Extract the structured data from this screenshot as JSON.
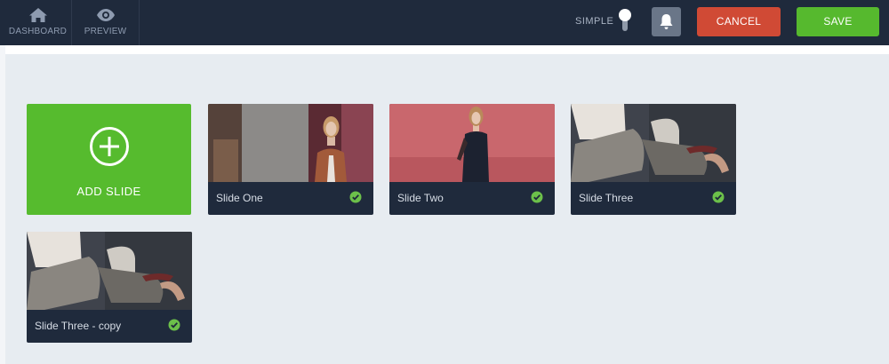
{
  "nav": {
    "dashboard_label": "DASHBOARD",
    "preview_label": "PREVIEW"
  },
  "header": {
    "mode_label": "SIMPLE",
    "cancel_label": "CANCEL",
    "save_label": "SAVE"
  },
  "add_slide": {
    "label": "ADD SLIDE"
  },
  "slides": [
    {
      "name": "Slide One",
      "status": "complete"
    },
    {
      "name": "Slide Two",
      "status": "complete"
    },
    {
      "name": "Slide Three",
      "status": "complete"
    },
    {
      "name": "Slide Three - copy",
      "status": "complete"
    }
  ],
  "colors": {
    "topbar": "#1f2a3c",
    "cancel": "#d04a35",
    "save": "#56b92e",
    "add_slide": "#56bb2e",
    "canvas": "#e7ecf1",
    "check": "#6cc04a"
  },
  "icons": {
    "dashboard": "home-icon",
    "preview": "eye-icon",
    "notifications": "bell-icon",
    "add": "plus-circle-icon",
    "status": "check-circle-icon"
  }
}
